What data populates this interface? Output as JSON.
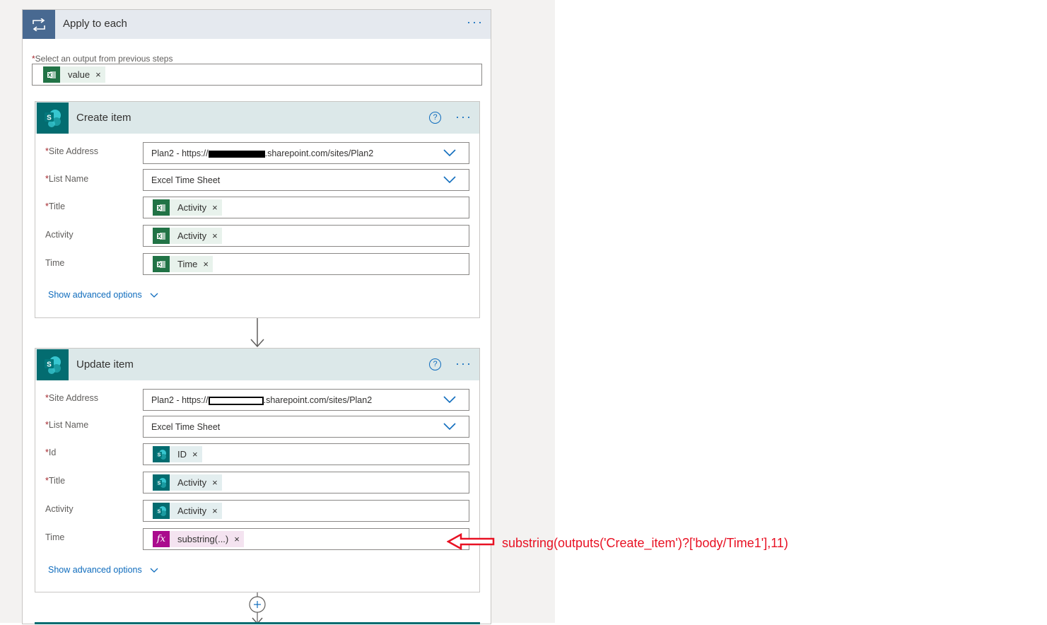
{
  "loop": {
    "title": "Apply to each",
    "required_mark": "*",
    "select_label": "Select an output from previous steps",
    "select_token": "value"
  },
  "create_item": {
    "title": "Create item",
    "help": "?",
    "fields": {
      "site_address_label": "Site Address",
      "site_address_prefix": "Plan2 - https://",
      "site_address_suffix": ".sharepoint.com/sites/Plan2",
      "list_name_label": "List Name",
      "list_name_value": "Excel Time Sheet",
      "title_label": "Title",
      "title_token": "Activity",
      "activity_label": "Activity",
      "activity_token": "Activity",
      "time_label": "Time",
      "time_token": "Time"
    },
    "advanced": "Show advanced options"
  },
  "update_item": {
    "title": "Update item",
    "help": "?",
    "fields": {
      "site_address_label": "Site Address",
      "site_address_prefix": "Plan2 - https://",
      "site_address_suffix": ".sharepoint.com/sites/Plan2",
      "list_name_label": "List Name",
      "list_name_value": "Excel Time Sheet",
      "id_label": "Id",
      "id_token": "ID",
      "title_label": "Title",
      "title_token": "Activity",
      "activity_label": "Activity",
      "activity_token": "Activity",
      "time_label": "Time",
      "time_token": "substring(...)"
    },
    "advanced": "Show advanced options"
  },
  "annotation": {
    "text": "substring(outputs('Create_item')?['body/Time1'],11)",
    "color": "#e81123"
  },
  "icons": {
    "loop": "loop-icon",
    "excel": "excel-icon",
    "sharepoint": "sharepoint-icon",
    "expression": "fx-icon",
    "more": "ellipsis-icon",
    "help": "help-icon",
    "dropdown": "chevron-down-icon",
    "add": "plus-circle-icon"
  },
  "colors": {
    "loop_header": "#486991",
    "sharepoint": "#036c70",
    "excel": "#217346",
    "expression": "#aa0b8d",
    "link": "#0f6cbd"
  }
}
